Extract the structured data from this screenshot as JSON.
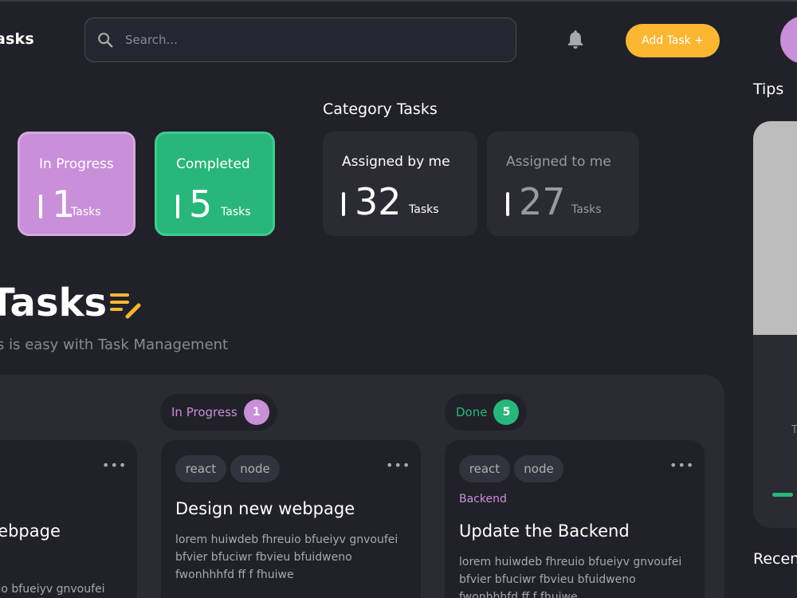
{
  "app": {
    "title": "asks"
  },
  "search": {
    "placeholder": "Search..."
  },
  "header": {
    "add_task_label": "Add Task +"
  },
  "category": {
    "title": "Category Tasks",
    "stats": [
      {
        "label": "In Progress",
        "value": "1",
        "unit": "Tasks",
        "color": "#c98fd8"
      },
      {
        "label": "Completed",
        "value": "5",
        "unit": "Tasks",
        "color": "#28b67a"
      },
      {
        "label": "Assigned by me",
        "value": "32",
        "unit": "Tasks"
      },
      {
        "label": "Assigned to me",
        "value": "27",
        "unit": "Tasks"
      }
    ]
  },
  "main": {
    "heading": "Tasks",
    "subtitle": "s is easy with Task Management"
  },
  "columns": [
    {
      "label": "In Progress",
      "count": "1",
      "color": "#c98fd8"
    },
    {
      "label": "Done",
      "count": "5",
      "color": "#28b67a"
    }
  ],
  "cards": [
    {
      "title": "webpage",
      "body": "euio bfueiyv gnvoufei"
    },
    {
      "tags": [
        "react",
        "node"
      ],
      "title": "Design new webpage",
      "body": "lorem huiwdeb fhreuio bfueiyv gnvoufei bfvier bfuciwr fbvieu bfuidweno fwonhhhfd ff f fhuiwe"
    },
    {
      "tags": [
        "react",
        "node"
      ],
      "category": "Backend",
      "title": "Update the Backend",
      "body": "lorem huiwdeb fhreuio bfueiyv gnvoufei bfvier bfuciwr fbvieu bfuidweno fwonhhhfd ff f fhuiwe"
    }
  ],
  "sidebar": {
    "tips_title": "Tips",
    "tips_letter": "T",
    "recent_title": "Recen"
  },
  "colors": {
    "accent": "#fbb632",
    "purple": "#c98fd8",
    "green": "#28b67a"
  }
}
